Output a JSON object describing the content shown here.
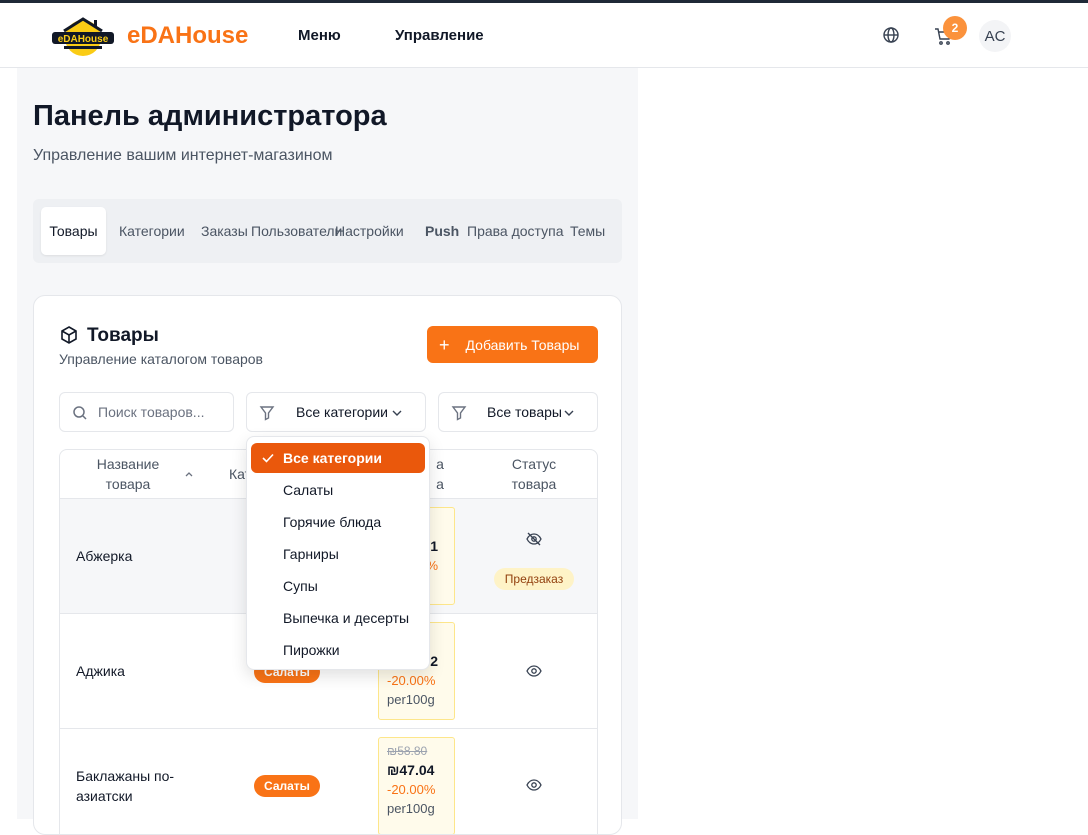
{
  "header": {
    "logo_text": "eDAHouse",
    "brand": "eDAHouse",
    "nav": [
      "Меню",
      "Управление"
    ],
    "cart_count": "2",
    "avatar": "AC"
  },
  "page": {
    "title": "Панель администратора",
    "subtitle": "Управление вашим интернет-магазином"
  },
  "tabs": [
    "Товары",
    "Категории",
    "Заказы",
    "Пользователи",
    "Настройки",
    "Push",
    "Права доступа",
    "Темы"
  ],
  "products": {
    "title": "Товары",
    "subtitle": "Управление каталогом товаров",
    "add_label": "Добавить Товары",
    "search_placeholder": "Поиск товаров...",
    "category_filter": "Все категории",
    "product_filter": "Все товары",
    "columns": {
      "name": "Название товара",
      "category": "Кат",
      "price": "а",
      "price2": "а",
      "status": "Статус товара"
    },
    "rows": [
      {
        "name": "Абжерка",
        "category": "",
        "price_new_partial": "1",
        "price_disc_partial": "%",
        "badge": "Предзаказ",
        "visible": false
      },
      {
        "name": "Аджика",
        "category": "Салаты",
        "price_new_partial": "2",
        "discount": "-20.00%",
        "unit": "per100g",
        "visible": true
      },
      {
        "name": "Баклажаны по-азиатски",
        "category": "Салаты",
        "price_old": "₪58.80",
        "price_new": "₪47.04",
        "discount": "-20.00%",
        "unit": "per100g",
        "visible": true
      }
    ]
  },
  "dropdown": {
    "options": [
      "Все категории",
      "Салаты",
      "Горячие блюда",
      "Гарниры",
      "Супы",
      "Выпечка и десерты",
      "Пирожки"
    ],
    "selected_index": 0
  },
  "colors": {
    "accent": "#f97316",
    "accent_dark": "#ea580c"
  }
}
